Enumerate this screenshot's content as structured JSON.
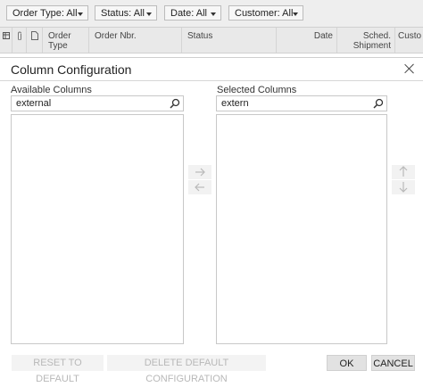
{
  "filters": [
    {
      "label": "Order Type: All"
    },
    {
      "label": "Status: All"
    },
    {
      "label": "Date: All"
    },
    {
      "label": "Customer: All"
    }
  ],
  "grid": {
    "columns": {
      "order_type_1": "Order",
      "order_type_2": "Type",
      "order_nbr": "Order Nbr.",
      "status": "Status",
      "date": "Date",
      "sched_1": "Sched.",
      "sched_2": "Shipment",
      "customer": "Custo"
    }
  },
  "dialog": {
    "title": "Column Configuration",
    "available_label": "Available Columns",
    "available_search": "external",
    "selected_label": "Selected Columns",
    "selected_search": "extern",
    "reset_label": "RESET TO DEFAULT",
    "delete_label": "DELETE DEFAULT CONFIGURATION",
    "ok_label": "OK",
    "cancel_label": "CANCEL"
  }
}
